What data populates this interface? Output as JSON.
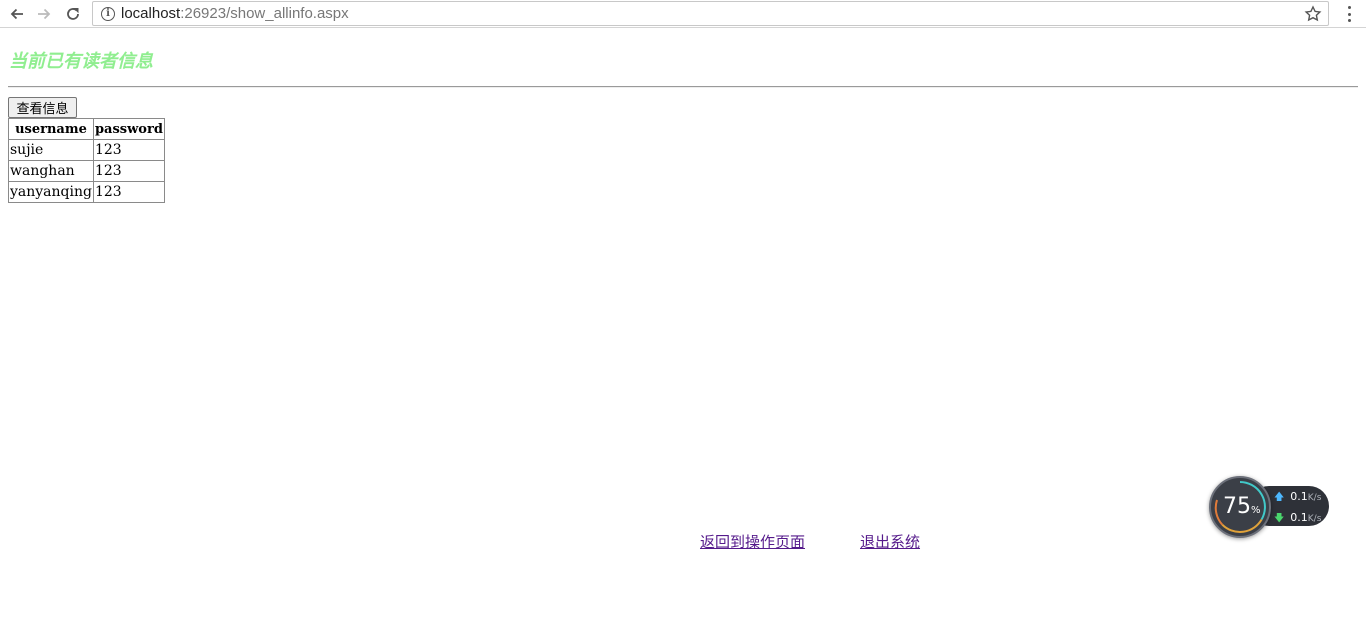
{
  "browser": {
    "url_host": "localhost",
    "url_rest": ":26923/show_allinfo.aspx"
  },
  "page": {
    "title": "当前已有读者信息",
    "view_button_label": "查看信息"
  },
  "table": {
    "headers": [
      "username",
      "password"
    ],
    "rows": [
      [
        "sujie",
        "123"
      ],
      [
        "wanghan",
        "123"
      ],
      [
        "yanyanqing",
        "123"
      ]
    ]
  },
  "links": {
    "back_label": "返回到操作页面",
    "exit_label": "退出系统"
  },
  "widget": {
    "percent": "75",
    "percent_unit": "%",
    "upload_value": "0.1",
    "upload_unit": "K/s",
    "download_value": "0.1",
    "download_unit": "K/s"
  },
  "colors": {
    "title": "#90ee90",
    "visited_link": "#551a8b"
  },
  "icons": [
    "back-arrow-icon",
    "forward-arrow-icon",
    "reload-icon",
    "info-icon",
    "star-icon",
    "menu-icon",
    "upload-arrow-icon",
    "download-arrow-icon"
  ]
}
